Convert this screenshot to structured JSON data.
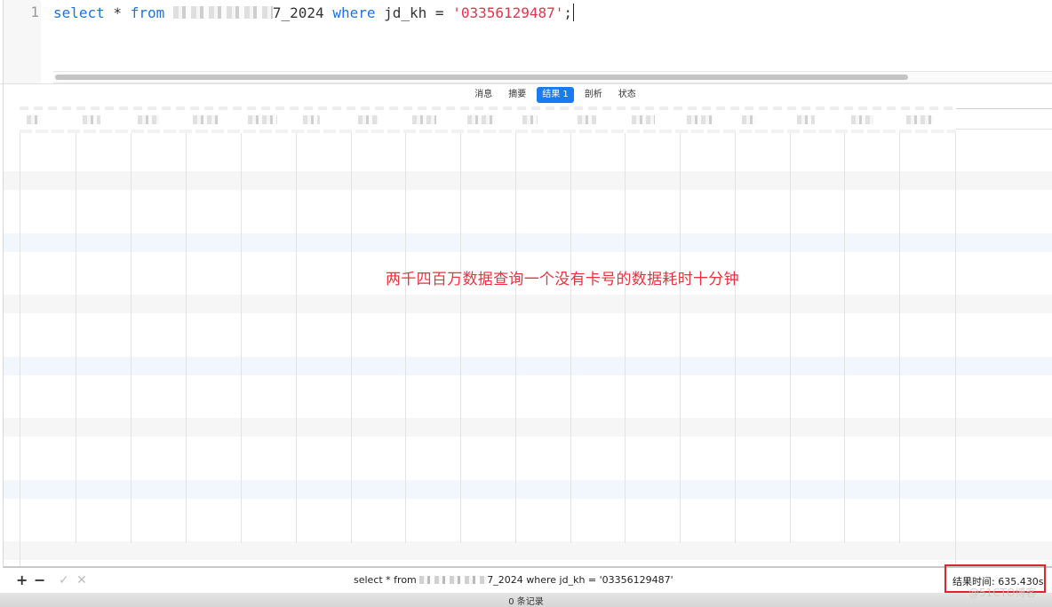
{
  "editor": {
    "line_number": "1",
    "tokens": {
      "kw_select": "select",
      "star": " * ",
      "kw_from": "from",
      "table_suffix": "7_2024",
      "kw_where": "where",
      "condition": " jd_kh = ",
      "value": "'03356129487'",
      "terminator": ";"
    },
    "horizontal_scroll": {
      "thumb_start_fraction": 0.0,
      "thumb_length_fraction": 0.85
    }
  },
  "tabs": [
    {
      "label": "消息",
      "active": false
    },
    {
      "label": "摘要",
      "active": false
    },
    {
      "label": "结果 1",
      "active": true
    },
    {
      "label": "剖析",
      "active": false
    },
    {
      "label": "状态",
      "active": false
    }
  ],
  "grid": {
    "column_count": 17,
    "rows": [],
    "header_labels_redacted": true
  },
  "annotation": "两千四百万数据查询一个没有卡号的数据耗时十分钟",
  "toolbar": {
    "add_label": "+",
    "remove_label": "−",
    "apply_label": "✓",
    "discard_label": "✕",
    "sql_prefix": "select * from ",
    "sql_suffix": "7_2024 where jd_kh = '03356129487'",
    "result_time": "结果时间: 635.430s"
  },
  "statusbar": {
    "record_count": "0 条记录"
  },
  "watermark": "@51CTO博客",
  "colors": {
    "keyword": "#1a73e8",
    "string": "#e8334a",
    "active_tab": "#1a7bf0",
    "annotation": "#e8323c",
    "highlight_box": "#e0242c"
  }
}
